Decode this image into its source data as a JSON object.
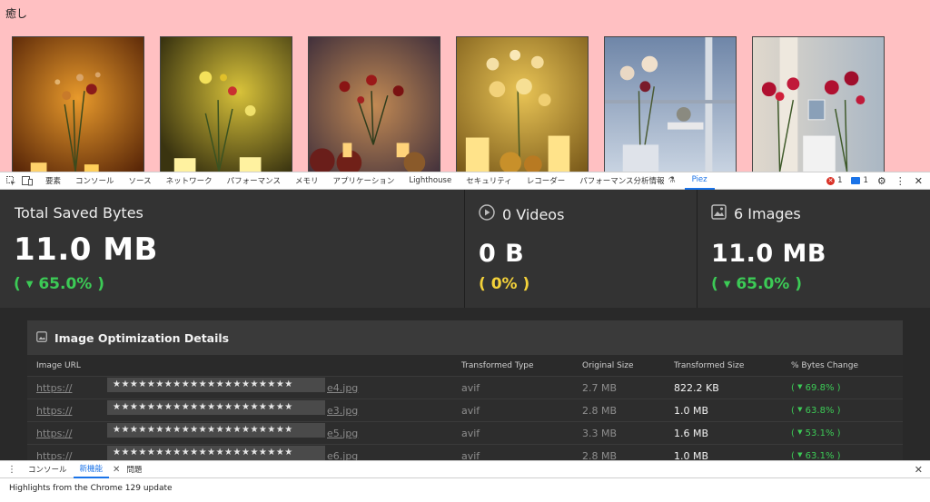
{
  "page": {
    "title": "癒し"
  },
  "devtools": {
    "tabs": [
      "要素",
      "コンソール",
      "ソース",
      "ネットワーク",
      "パフォーマンス",
      "メモリ",
      "アプリケーション",
      "Lighthouse",
      "セキュリティ",
      "レコーダー",
      "パフォーマンス分析情報",
      "Piez"
    ],
    "active_tab": "Piez",
    "error_count": "1",
    "message_count": "1"
  },
  "stats": {
    "total": {
      "label": "Total Saved Bytes",
      "value": "11.0 MB",
      "change": "65.0%"
    },
    "videos": {
      "label": "0 Videos",
      "value": "0 B",
      "change": "0%"
    },
    "images": {
      "label": "6 Images",
      "value": "11.0 MB",
      "change": "65.0%"
    }
  },
  "details": {
    "title": "Image Optimization Details",
    "columns": [
      "Image URL",
      "Transformed Type",
      "Original Size",
      "Transformed Size",
      "% Bytes Change"
    ],
    "rows": [
      {
        "url_prefix": "https://",
        "url_mask": "★★★★★★★★★★★★★★★★★★★★★",
        "url_suffix": "e4.jpg",
        "type": "avif",
        "original": "2.7 MB",
        "transformed": "822.2 KB",
        "change": "69.8%"
      },
      {
        "url_prefix": "https://",
        "url_mask": "★★★★★★★★★★★★★★★★★★★★★",
        "url_suffix": "e3.jpg",
        "type": "avif",
        "original": "2.8 MB",
        "transformed": "1.0 MB",
        "change": "63.8%"
      },
      {
        "url_prefix": "https://",
        "url_mask": "★★★★★★★★★★★★★★★★★★★★★",
        "url_suffix": "e5.jpg",
        "type": "avif",
        "original": "3.3 MB",
        "transformed": "1.6 MB",
        "change": "53.1%"
      },
      {
        "url_prefix": "https://",
        "url_mask": "★★★★★★★★★★★★★★★★★★★★★",
        "url_suffix": "e6.jpg",
        "type": "avif",
        "original": "2.8 MB",
        "transformed": "1.0 MB",
        "change": "63.1%"
      }
    ]
  },
  "drawer": {
    "tabs": [
      "コンソール",
      "新機能",
      "問題"
    ],
    "active_tab": "新機能",
    "message": "Highlights from the Chrome 129 update"
  },
  "colors": {
    "page_bg": "#ffc0c2",
    "panel_bg": "#292929",
    "positive": "#3ccb56",
    "neutral": "#f4d23a",
    "accent": "#1a73e8"
  }
}
